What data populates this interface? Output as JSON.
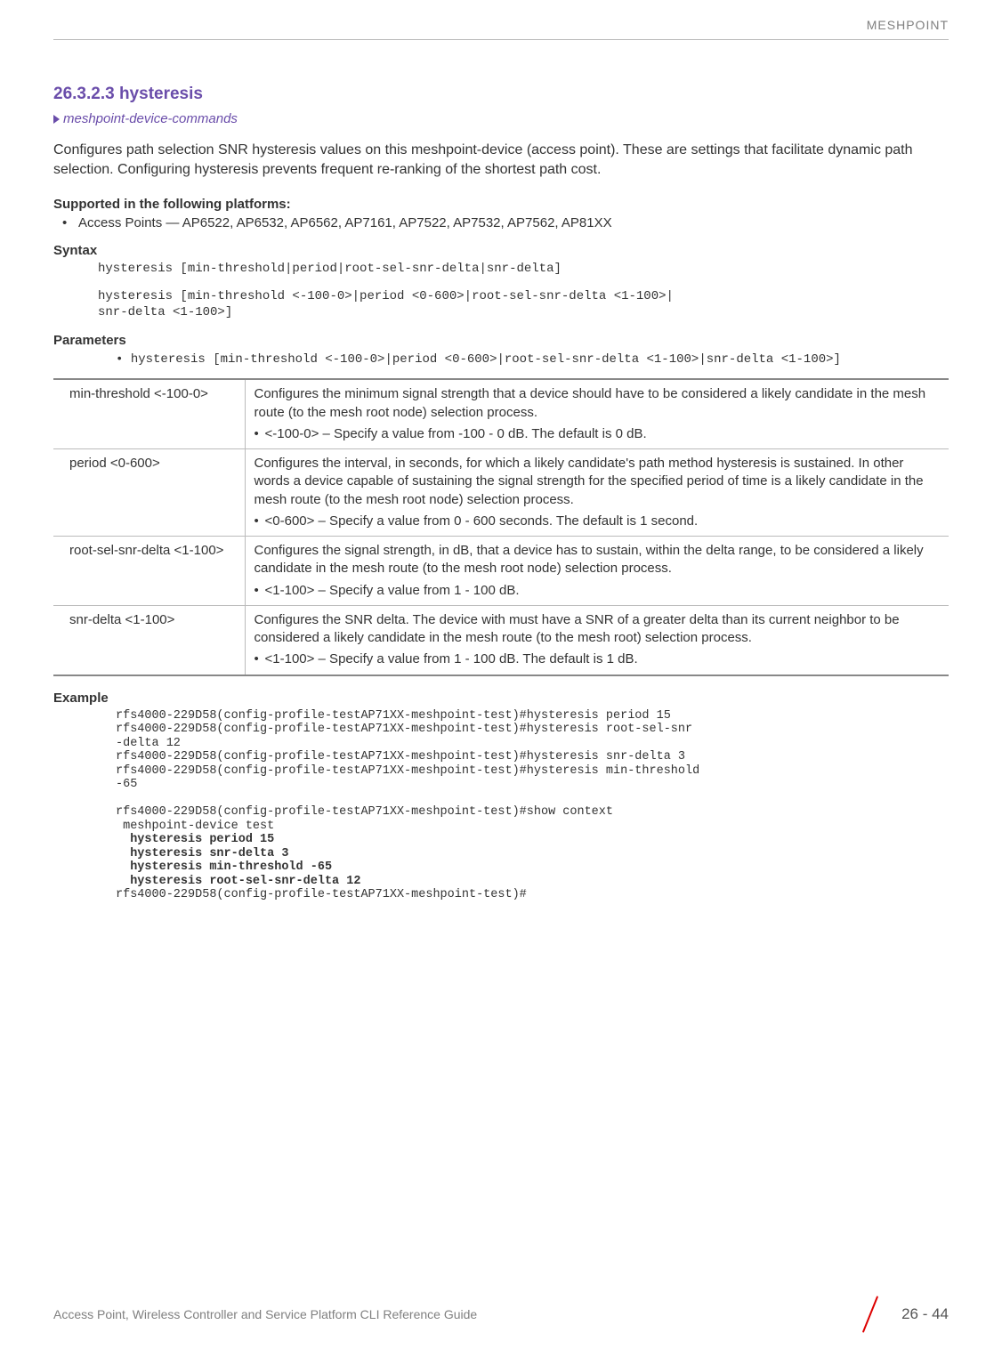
{
  "header": {
    "right_label": "MESHPOINT"
  },
  "section": {
    "title": "26.3.2.3 hysteresis",
    "nav_link": "meshpoint-device-commands",
    "intro": "Configures path selection SNR hysteresis values on this meshpoint-device (access point). These are settings that facilitate dynamic path selection. Configuring hysteresis prevents frequent re-ranking of the shortest path cost."
  },
  "supported": {
    "heading": "Supported in the following platforms:",
    "item": "Access Points — AP6522, AP6532, AP6562, AP7161, AP7522, AP7532, AP7562, AP81XX"
  },
  "syntax": {
    "heading": "Syntax",
    "line1": "hysteresis [min-threshold|period|root-sel-snr-delta|snr-delta]",
    "line2": "hysteresis [min-threshold <-100-0>|period <0-600>|root-sel-snr-delta <1-100>|\nsnr-delta <1-100>]"
  },
  "parameters": {
    "heading": "Parameters",
    "code": "hysteresis [min-threshold <-100-0>|period <0-600>|root-sel-snr-delta <1-100>|snr-delta <1-100>]",
    "rows": [
      {
        "name": "min-threshold <-100-0>",
        "desc": "Configures the minimum signal strength that a device should have to be considered a likely candidate in the mesh route (to the mesh root node) selection process.",
        "bullet": "<-100-0> – Specify a value from -100 - 0 dB. The default is 0 dB."
      },
      {
        "name": "period <0-600>",
        "desc": "Configures the interval, in seconds, for which a likely candidate's path method hysteresis is sustained. In other words a device capable of sustaining the signal strength for the specified period of time is a likely candidate in the mesh route (to the mesh root node) selection process.",
        "bullet": "<0-600> – Specify a value from 0 - 600 seconds. The default is 1 second."
      },
      {
        "name": "root-sel-snr-delta <1-100>",
        "desc": "Configures the signal strength, in dB, that a device has to sustain, within the delta range, to be considered a likely candidate in the mesh route (to the mesh root node) selection process.",
        "bullet": "<1-100> – Specify a value from 1 - 100 dB."
      },
      {
        "name": "snr-delta <1-100>",
        "desc": "Configures the SNR delta. The device with must have a SNR of a greater delta than its current neighbor to be considered a likely candidate in the mesh route (to the mesh root) selection process.",
        "bullet": "<1-100> – Specify a value from 1 - 100 dB. The default is 1 dB."
      }
    ]
  },
  "example": {
    "heading": "Example",
    "lines_part1": "rfs4000-229D58(config-profile-testAP71XX-meshpoint-test)#hysteresis period 15\nrfs4000-229D58(config-profile-testAP71XX-meshpoint-test)#hysteresis root-sel-snr\n-delta 12\nrfs4000-229D58(config-profile-testAP71XX-meshpoint-test)#hysteresis snr-delta 3\nrfs4000-229D58(config-profile-testAP71XX-meshpoint-test)#hysteresis min-threshold \n-65\n\nrfs4000-229D58(config-profile-testAP71XX-meshpoint-test)#show context\n meshpoint-device test",
    "bold1": "  hysteresis period 15",
    "bold2": "  hysteresis snr-delta 3",
    "bold3": "  hysteresis min-threshold -65",
    "bold4": "  hysteresis root-sel-snr-delta 12",
    "line_last": "rfs4000-229D58(config-profile-testAP71XX-meshpoint-test)#"
  },
  "footer": {
    "left": "Access Point, Wireless Controller and Service Platform CLI Reference Guide",
    "page": "26 - 44"
  }
}
